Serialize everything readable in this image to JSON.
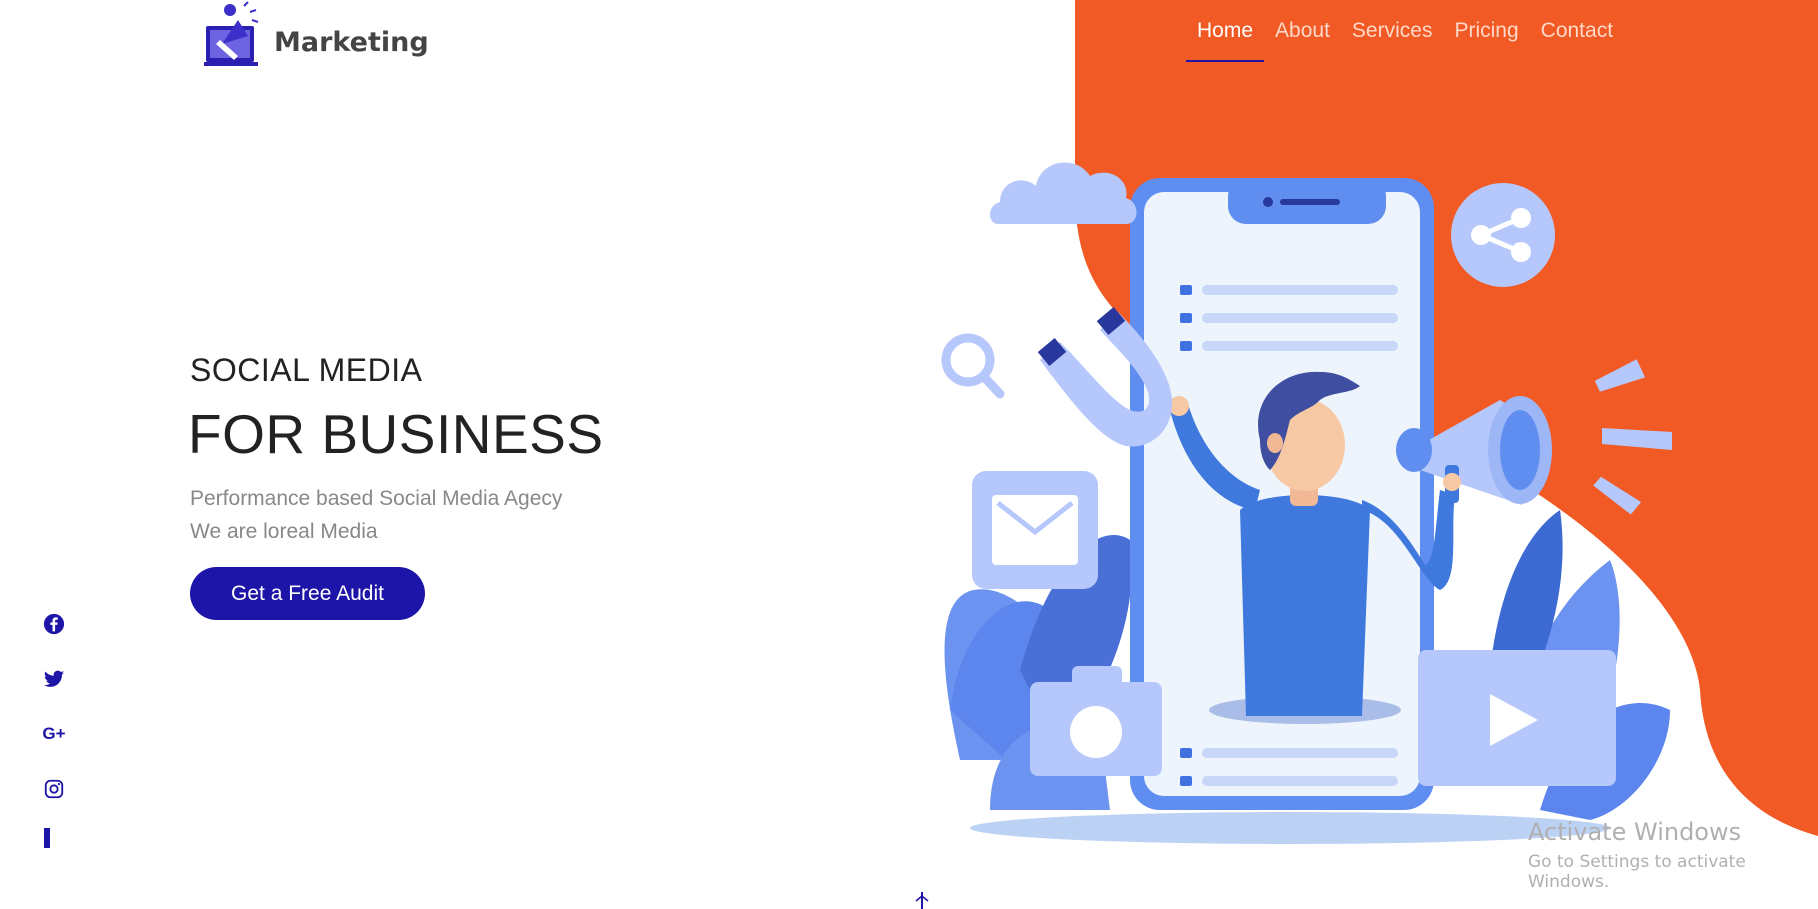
{
  "brand": {
    "name": "Marketing",
    "logo_icon": "megaphone-laptop-icon"
  },
  "nav": {
    "items": [
      {
        "label": "Home",
        "active": true
      },
      {
        "label": "About",
        "active": false
      },
      {
        "label": "Services",
        "active": false
      },
      {
        "label": "Pricing",
        "active": false
      },
      {
        "label": "Contact",
        "active": false
      }
    ]
  },
  "hero": {
    "kicker": "SOCIAL MEDIA",
    "title": "FOR BUSINESS",
    "subtitle_line1": "Performance based Social Media Agecy",
    "subtitle_line2": "We are loreal Media",
    "cta_label": "Get a Free Audit"
  },
  "socials": {
    "items": [
      {
        "name": "facebook-icon"
      },
      {
        "name": "twitter-icon"
      },
      {
        "name": "google-plus-icon",
        "glyph": "G+"
      },
      {
        "name": "instagram-icon"
      }
    ]
  },
  "watermark": {
    "title": "Activate Windows",
    "subtitle": "Go to Settings to activate Windows."
  },
  "colors": {
    "accent": "#1d14a8",
    "orange": "#f15a24",
    "illustration_blue": "#4a7de0",
    "illustration_light": "#b6c8fb"
  }
}
